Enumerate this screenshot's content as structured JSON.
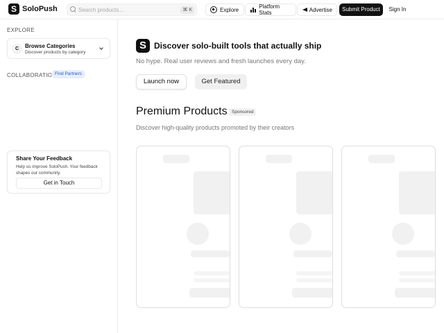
{
  "header": {
    "brand": "SoloPush",
    "logo_letter": "S",
    "search_placeholder": "Search products...",
    "search_shortcut": "⌘ K",
    "nav": {
      "explore": "Explore",
      "platform_stats": "Platform Stats",
      "advertise": "Advertise"
    },
    "submit_label": "Submit Product",
    "signin_label": "Sign In"
  },
  "sidebar": {
    "explore_label": "EXPLORE",
    "browse": {
      "badge": "C",
      "title": "Browse Categories",
      "subtitle": "Discover products by category"
    },
    "collaboration_label": "COLLABORATION",
    "partners_label": "Find Partners",
    "feedback": {
      "title": "Share Your Feedback",
      "text": "Help us improve SoloPush. Your feedback shapes our community.",
      "button": "Get in Touch"
    }
  },
  "main": {
    "hero": {
      "logo_letter": "S",
      "title": "Discover solo-built tools that actually ship",
      "subtitle": "No hype. Real user reviews and fresh launches every day.",
      "launch_label": "Launch now",
      "featured_label": "Get Featured"
    },
    "premium": {
      "title": "Premium Products",
      "sponsored_label": "Sponsored",
      "subtitle": "Discover high-quality products promoted by their creators",
      "cards_loading": 3
    }
  },
  "colors": {
    "primary": "#111111",
    "accent_pill_bg": "#e6eefc",
    "accent_pill_text": "#2a57c5",
    "skeleton": "#f1f1f1"
  }
}
